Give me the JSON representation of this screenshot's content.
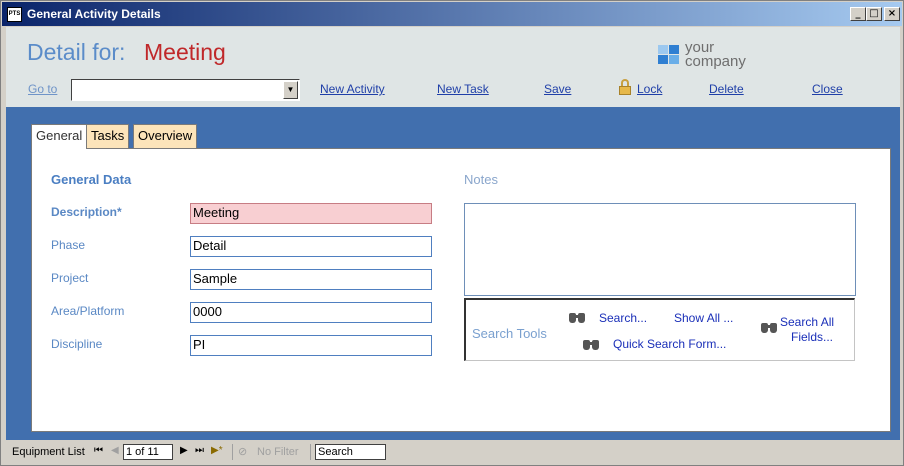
{
  "window": {
    "title": "General Activity Details",
    "icon_text": "PTS",
    "minimize_glyph": "_",
    "maximize_glyph": "□",
    "close_glyph": "×"
  },
  "header": {
    "detail_label": "Detail for:",
    "detail_value": "Meeting",
    "logo_line1": "your",
    "logo_line2": "company",
    "goto_label": "Go to",
    "goto_value": "",
    "goto_arrow": "▼",
    "actions": {
      "new_activity": "New Activity",
      "new_task": "New Task",
      "save": "Save",
      "lock": "Lock",
      "delete": "Delete",
      "close": "Close"
    }
  },
  "tabs": [
    {
      "label": "General",
      "active": true
    },
    {
      "label": "Tasks",
      "active": false
    },
    {
      "label": "Overview",
      "active": false
    }
  ],
  "general": {
    "section_title": "General Data",
    "fields": [
      {
        "label": "Description*",
        "value": "Meeting",
        "required": true
      },
      {
        "label": "Phase",
        "value": "Detail",
        "required": false
      },
      {
        "label": "Project",
        "value": "Sample",
        "required": false
      },
      {
        "label": "Area/Platform",
        "value": "0000",
        "required": false
      },
      {
        "label": "Discipline",
        "value": "PI",
        "required": false
      }
    ],
    "notes_label": "Notes",
    "notes_value": ""
  },
  "search_tools": {
    "label": "Search Tools",
    "search": "Search...",
    "show_all": "Show All ...",
    "search_all_line1": "Search All",
    "search_all_line2": "Fields...",
    "quick_search": "Quick Search Form..."
  },
  "navigation": {
    "label": "Equipment List",
    "first": "⏮",
    "prev": "◀",
    "record": "1 of 11",
    "next": "▶",
    "last": "⏭",
    "new": "▶*",
    "filter_icon": "⊘",
    "filter": "No Filter",
    "search_placeholder": "Search"
  },
  "colors": {
    "title_bar_start": "#0a246a",
    "body_blue": "#416fae",
    "detail_value_red": "#c0282a",
    "required_field_bg": "#f8cfd2"
  }
}
